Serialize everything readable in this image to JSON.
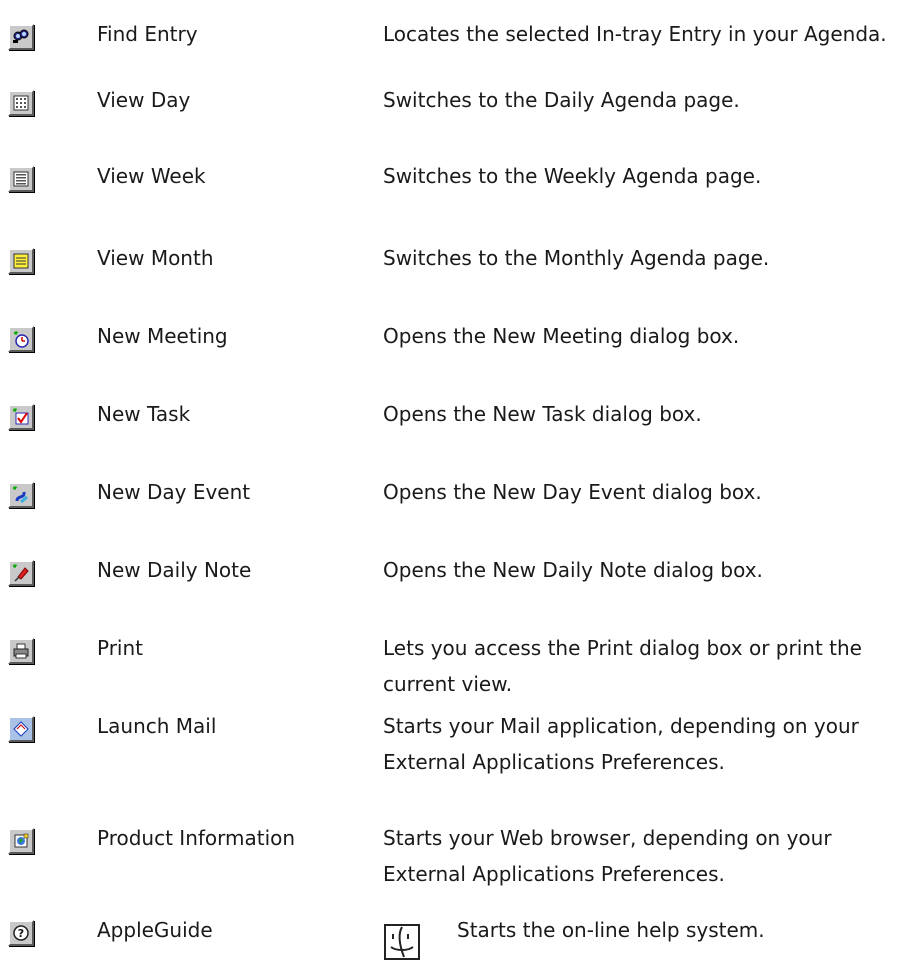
{
  "rows": [
    {
      "icon": "find-entry-icon",
      "name": "Find Entry",
      "desc": [
        "Locates the selected In-tray Entry in your Agenda."
      ]
    },
    {
      "icon": "view-day-icon",
      "name": "View Day",
      "desc": [
        "Switches to the Daily Agenda page."
      ]
    },
    {
      "icon": "view-week-icon",
      "name": "View Week",
      "desc": [
        "Switches to the Weekly Agenda page."
      ]
    },
    {
      "icon": "view-month-icon",
      "name": "View Month",
      "desc": [
        "Switches to the Monthly Agenda page."
      ]
    },
    {
      "icon": "new-meeting-icon",
      "name": "New Meeting",
      "desc": [
        "Opens the New Meeting dialog box."
      ]
    },
    {
      "icon": "new-task-icon",
      "name": "New Task",
      "desc": [
        "Opens the New Task dialog box."
      ]
    },
    {
      "icon": "new-day-event-icon",
      "name": "New Day Event",
      "desc": [
        "Opens the New Day Event dialog box."
      ]
    },
    {
      "icon": "new-daily-note-icon",
      "name": "New Daily Note",
      "desc": [
        "Opens the New Daily Note dialog box."
      ]
    },
    {
      "icon": "print-icon",
      "name": "Print",
      "desc": [
        "Lets you access the Print dialog box or print the",
        "current view."
      ]
    },
    {
      "icon": "launch-mail-icon",
      "name": "Launch Mail",
      "desc": [
        "Starts your Mail application, depending on your",
        "External Applications Preferences."
      ]
    },
    {
      "icon": "product-information-icon",
      "name": "Product Information",
      "desc": [
        "Starts your Web browser, depending on your",
        "External Applications Preferences."
      ]
    },
    {
      "icon": "appleguide-icon",
      "name": "AppleGuide",
      "desc": [
        "Starts the on-line help system."
      ],
      "extra_icon": "mac-finder-icon"
    }
  ]
}
